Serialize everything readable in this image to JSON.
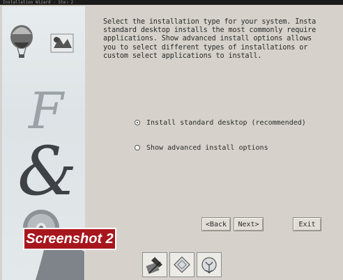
{
  "window": {
    "title": "Installation Wizard - Step 2"
  },
  "instructions": "Select the installation type for your system. Insta\nstandard desktop installs the most commonly require\napplications. Show advanced install options allows\nyou to select different types of installations or\ncustom select applications to install.",
  "options": {
    "standard": {
      "label": "Install standard desktop (recommended)",
      "selected": true
    },
    "advanced": {
      "label": "Show advanced install options",
      "selected": false
    }
  },
  "buttons": {
    "back": "<Back",
    "next": "Next>",
    "exit": "Exit"
  },
  "badge": "Screenshot 2",
  "footer_icons": [
    "package-install-icon",
    "disc-icon",
    "network-install-icon"
  ],
  "colors": {
    "badge": "#a8161d",
    "dialog_bg": "#d6d2cb"
  }
}
